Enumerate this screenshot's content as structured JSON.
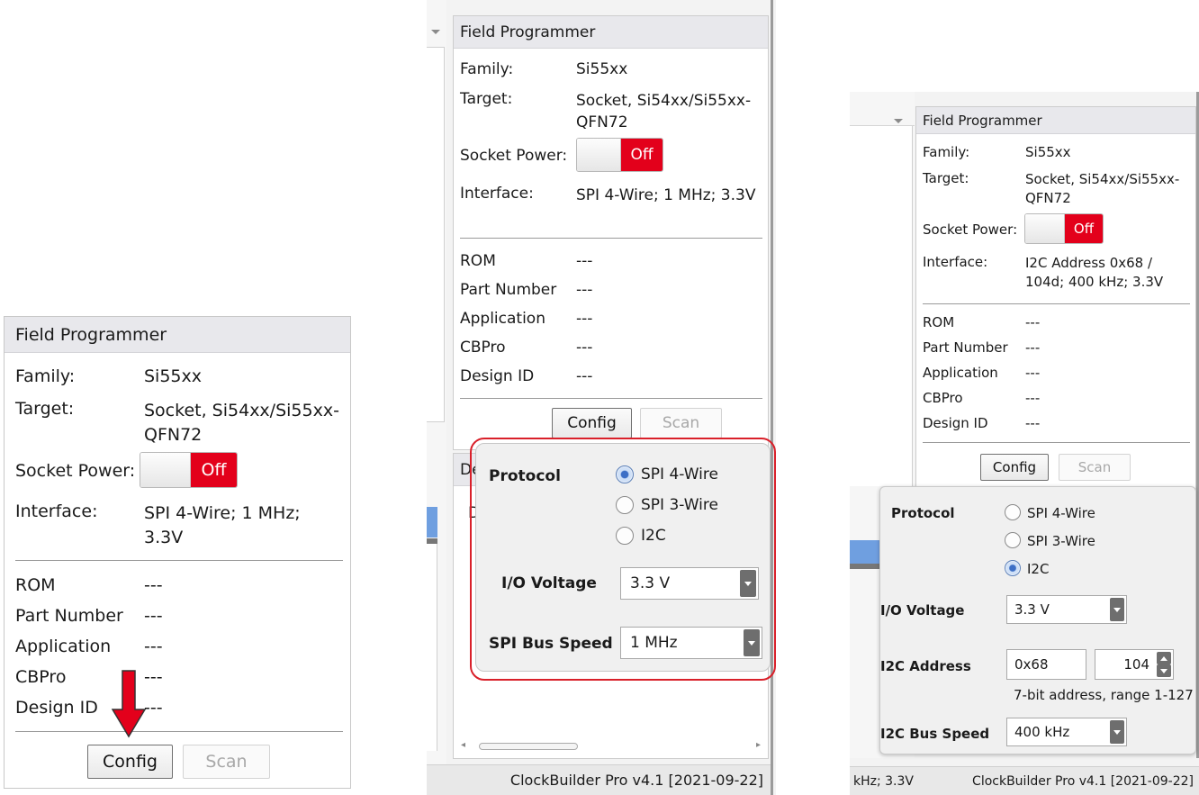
{
  "panel": {
    "title": "Field Programmer",
    "family_label": "Family:",
    "family_value": "Si55xx",
    "target_label": "Target:",
    "target_value": "Socket, Si54xx/Si55xx-QFN72",
    "socket_power_label": "Socket Power:",
    "socket_power_state": "Off",
    "interface_label": "Interface:",
    "interface_value_spi": "SPI 4-Wire; 1 MHz; 3.3V",
    "interface_value_i2c": "I2C Address 0x68 / 104d; 400 kHz; 3.3V",
    "rom_label": "ROM",
    "part_number_label": "Part Number",
    "application_label": "Application",
    "cbpro_label": "CBPro",
    "design_id_label": "Design ID",
    "empty_value": "---",
    "config_button": "Config",
    "scan_button": "Scan"
  },
  "popup_spi": {
    "protocol_label": "Protocol",
    "options": [
      "SPI 4-Wire",
      "SPI 3-Wire",
      "I2C"
    ],
    "selected": "SPI 4-Wire",
    "io_voltage_label": "I/O Voltage",
    "io_voltage_value": "3.3 V",
    "bus_speed_label": "SPI Bus Speed",
    "bus_speed_value": "1 MHz"
  },
  "popup_i2c": {
    "protocol_label": "Protocol",
    "options": [
      "SPI 4-Wire",
      "SPI 3-Wire",
      "I2C"
    ],
    "selected": "I2C",
    "io_voltage_label": "I/O Voltage",
    "io_voltage_value": "3.3 V",
    "address_label": "I2C Address",
    "address_hex": "0x68",
    "address_dec": "104",
    "address_hint": "7-bit address, range 1-127",
    "bus_speed_label": "I2C Bus Speed",
    "bus_speed_value": "400 kHz"
  },
  "middle_partial": {
    "tab_fragment": "De",
    "item_fragment": "D"
  },
  "status": {
    "version": "ClockBuilder Pro v4.1 [2021-09-22]",
    "left_fragment": "kHz; 3.3V"
  },
  "colors": {
    "off_red": "#e3001b",
    "arrow_red": "#e3001b",
    "highlight_red": "#d9202a",
    "header_gray": "#e8e8ec",
    "radio_blue": "#3d6fc6",
    "accent_blue": "#6f9fe0"
  }
}
